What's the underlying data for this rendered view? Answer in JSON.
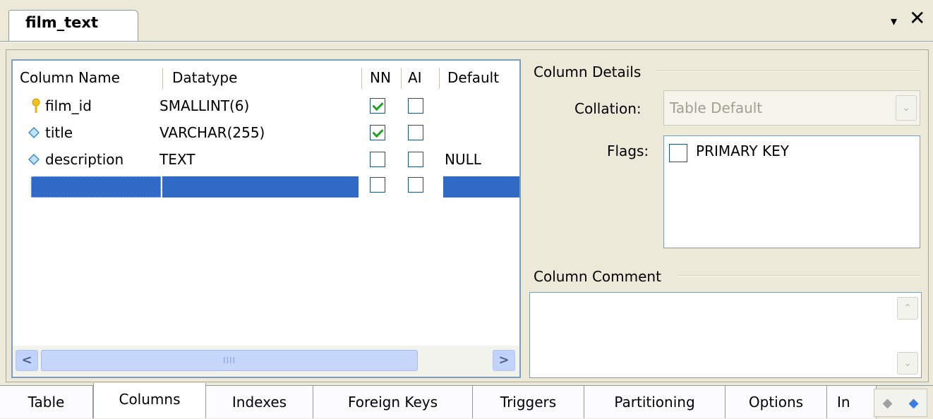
{
  "document": {
    "tab_title": "film_text",
    "menu_arrow": "▾",
    "close": "✕"
  },
  "grid": {
    "headers": [
      "Column Name",
      "Datatype",
      "NN",
      "AI",
      "Default"
    ],
    "rows": [
      {
        "icon": "key-icon",
        "name": "film_id",
        "datatype": "SMALLINT(6)",
        "nn": true,
        "ai": false,
        "default": ""
      },
      {
        "icon": "diamond-icon",
        "name": "title",
        "datatype": "VARCHAR(255)",
        "nn": true,
        "ai": false,
        "default": ""
      },
      {
        "icon": "diamond-icon",
        "name": "description",
        "datatype": "TEXT",
        "nn": false,
        "ai": false,
        "default": "NULL"
      },
      {
        "icon": "",
        "name": "",
        "datatype": "",
        "nn": false,
        "ai": false,
        "default": ""
      }
    ],
    "hscroll": {
      "left": "<",
      "right": ">",
      "thumb_grip": "IIII"
    }
  },
  "details": {
    "title": "Column Details",
    "collation_label": "Collation:",
    "collation_value": "Table Default",
    "collation_arrow": "⌄",
    "flags_label": "Flags:",
    "flags": [
      {
        "label": "PRIMARY KEY",
        "checked": false
      }
    ],
    "comment_title": "Column Comment",
    "comment_value": "",
    "scroll_up": "⌃",
    "scroll_down": "⌄"
  },
  "bottom_tabs": {
    "items": [
      "Table",
      "Columns",
      "Indexes",
      "Foreign Keys",
      "Triggers",
      "Partitioning",
      "Options",
      "In"
    ],
    "active": "Columns",
    "nav_left": "◆",
    "nav_right": "◆"
  },
  "colors": {
    "selection": "#316ac5",
    "check": "#21a121",
    "key": "#f2c21b",
    "diamond": "#3f8bd0"
  }
}
